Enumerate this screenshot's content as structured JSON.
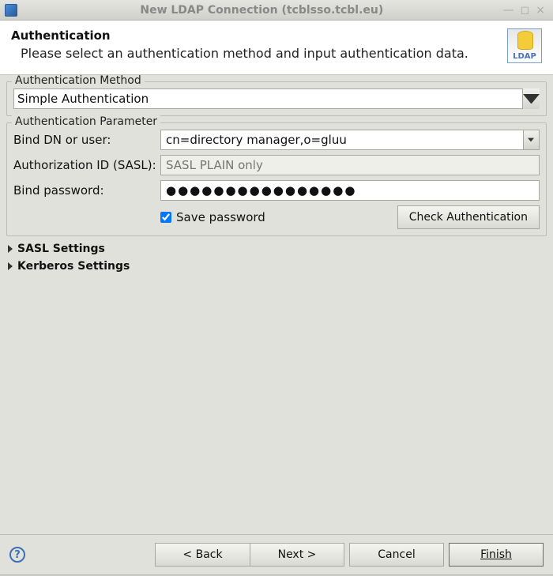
{
  "window": {
    "title": "New LDAP Connection  (tcblsso.tcbl.eu)"
  },
  "header": {
    "title": "Authentication",
    "subtitle": "Please select an authentication method and input authentication data.",
    "badge": "LDAP"
  },
  "auth_method": {
    "legend": "Authentication Method",
    "selected": "Simple Authentication"
  },
  "auth_param": {
    "legend": "Authentication Parameter",
    "bind_dn_label": "Bind DN or user:",
    "bind_dn_value": "cn=directory manager,o=gluu",
    "auth_id_label": "Authorization ID (SASL):",
    "auth_id_placeholder": "SASL PLAIN only",
    "bind_pw_label": "Bind password:",
    "bind_pw_value": "●●●●●●●●●●●●●●●●",
    "save_pw_label": "Save password",
    "save_pw_checked": true,
    "check_auth_label": "Check Authentication"
  },
  "expanders": {
    "sasl": "SASL Settings",
    "kerberos": "Kerberos Settings"
  },
  "footer": {
    "back": "< Back",
    "next": "Next >",
    "cancel": "Cancel",
    "finish": "Finish"
  }
}
